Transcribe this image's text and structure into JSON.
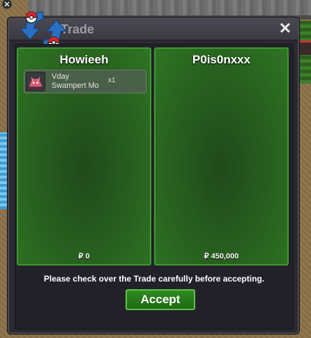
{
  "window": {
    "title": "Trade",
    "close_icon": "close-icon"
  },
  "trade": {
    "left": {
      "name": "Howieeh",
      "items": [
        {
          "line1": "Vday",
          "line2": "Swampert Mo",
          "qty": "x1",
          "icon": "swampert-item-icon"
        }
      ],
      "money": "₽ 0"
    },
    "right": {
      "name": "P0is0nxxx",
      "items": [],
      "money": "₽ 450,000"
    }
  },
  "footer": {
    "notice": "Please check over the Trade carefully before accepting.",
    "accept_label": "Accept"
  },
  "colors": {
    "panel_border": "#3e9a31",
    "accept_bg": "#2f8a1f",
    "window_bg": "#2b2a30"
  }
}
